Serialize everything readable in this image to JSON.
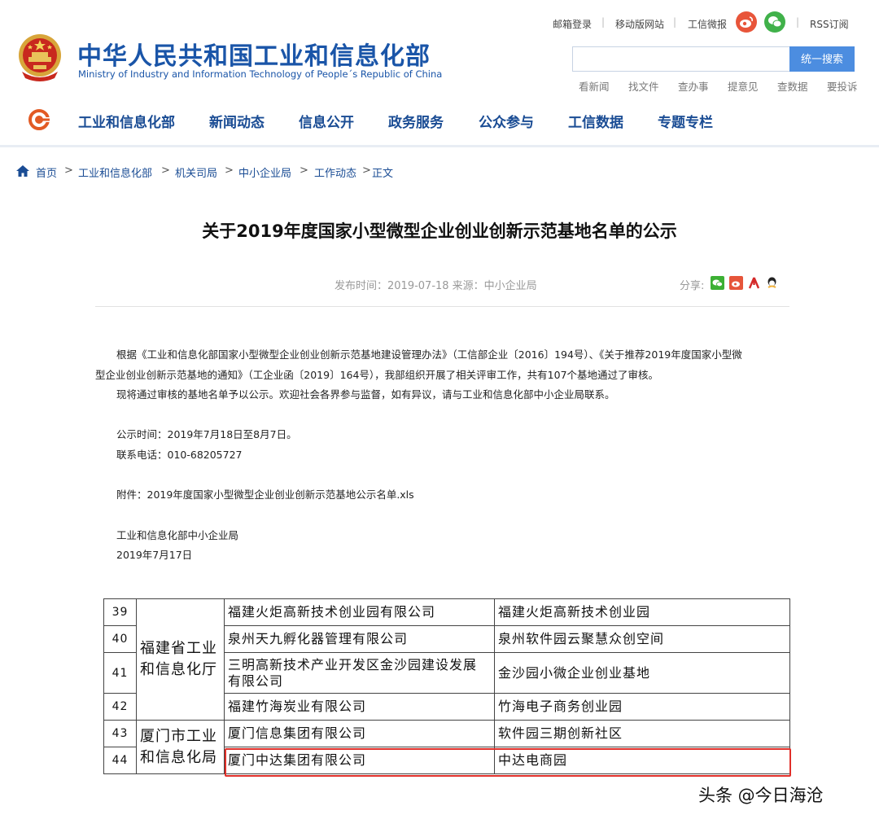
{
  "header": {
    "title_cn": "中华人民共和国工业和信息化部",
    "title_en": "Ministry of Industry and Information Technology of People´s Republic of China",
    "top_links": [
      "邮箱登录",
      "移动版网站",
      "工信微报",
      "RSS订阅"
    ],
    "search": {
      "placeholder": "",
      "button_label": "统一搜索"
    },
    "quick_links": [
      "看新闻",
      "找文件",
      "查办事",
      "提意见",
      "查数据",
      "要投诉"
    ]
  },
  "nav": {
    "items": [
      "工业和信息化部",
      "新闻动态",
      "信息公开",
      "政务服务",
      "公众参与",
      "工信数据",
      "专题专栏"
    ]
  },
  "breadcrumb": {
    "items": [
      "首页",
      "工业和信息化部",
      "机关司局",
      "中小企业局",
      "工作动态",
      "正文"
    ],
    "separator": ">"
  },
  "article": {
    "title": "关于2019年度国家小型微型企业创业创新示范基地名单的公示",
    "meta": "发布时间：2019-07-18 来源：中小企业局",
    "share_label": "分享:",
    "paragraph1_line1": "根据《工业和信息化部国家小型微型企业创业创新示范基地建设管理办法》（工信部企业〔2016〕194号）、《关于推荐2019年度国家小型微",
    "paragraph1_line2": "型企业创业创新示范基地的通知》（工企业函〔2019〕164号），我部组织开展了相关评审工作，共有107个基地通过了审核。",
    "paragraph2": "现将通过审核的基地名单予以公示。欢迎社会各界参与监督，如有异议，请与工业和信息化部中小企业局联系。",
    "notice_time": "公示时间：2019年7月18日至8月7日。",
    "phone": "联系电话：010-68205727",
    "attachment": "附件：2019年度国家小型微型企业创业创新示范基地公示名单.xls",
    "signature_org": "工业和信息化部中小企业局",
    "signature_date": "2019年7月17日"
  },
  "table": {
    "rows": [
      {
        "num": "39",
        "company": "福建火炬高新技术创业园有限公司",
        "base": "福建火炬高新技术创业园"
      },
      {
        "num": "40",
        "company": "泉州天九孵化器管理有限公司",
        "base": "泉州软件园云聚慧众创空间"
      },
      {
        "num": "41",
        "company_line1": "三明高新技术产业开发区金沙园建设发展",
        "company_line2": "有限公司",
        "base": "金沙园小微企业创业基地"
      },
      {
        "num": "42",
        "company": "福建竹海炭业有限公司",
        "base": "竹海电子商务创业园"
      },
      {
        "num": "43",
        "company": "厦门信息集团有限公司",
        "base": "软件园三期创新社区"
      },
      {
        "num": "44",
        "company": "厦门中达集团有限公司",
        "base": "中达电商园"
      }
    ],
    "region_fujian_line1": "福建省工业",
    "region_fujian_line2": "和信息化厅",
    "region_xiamen_line1": "厦门市工业",
    "region_xiamen_line2": "和信息化局"
  },
  "watermark": "头条 @今日海沧",
  "colors": {
    "brand_blue": "#1a55a8",
    "nav_blue": "#1a4c94",
    "search_button": "#4c8de0",
    "highlight_red": "#e0302a"
  }
}
